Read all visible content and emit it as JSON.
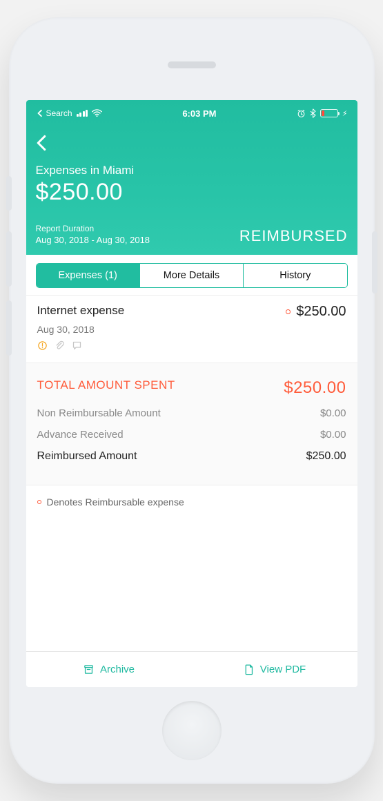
{
  "status_bar": {
    "back_label": "Search",
    "time": "6:03 PM"
  },
  "header": {
    "title": "Expenses in Miami",
    "amount": "$250.00",
    "duration_label": "Report Duration",
    "duration_range": "Aug 30, 2018 - Aug 30, 2018",
    "status": "REIMBURSED"
  },
  "tabs": [
    {
      "label": "Expenses (1)",
      "active": true
    },
    {
      "label": "More Details",
      "active": false
    },
    {
      "label": "History",
      "active": false
    }
  ],
  "expense": {
    "name": "Internet expense",
    "date": "Aug 30, 2018",
    "amount": "$250.00"
  },
  "summary": {
    "total_label": "TOTAL AMOUNT SPENT",
    "total_value": "$250.00",
    "non_reimbursable_label": "Non Reimbursable Amount",
    "non_reimbursable_value": "$0.00",
    "advance_label": "Advance Received",
    "advance_value": "$0.00",
    "reimbursed_label": "Reimbursed Amount",
    "reimbursed_value": "$250.00"
  },
  "legend": {
    "text": "Denotes Reimbursable expense"
  },
  "bottom": {
    "archive_label": "Archive",
    "view_pdf_label": "View PDF"
  }
}
